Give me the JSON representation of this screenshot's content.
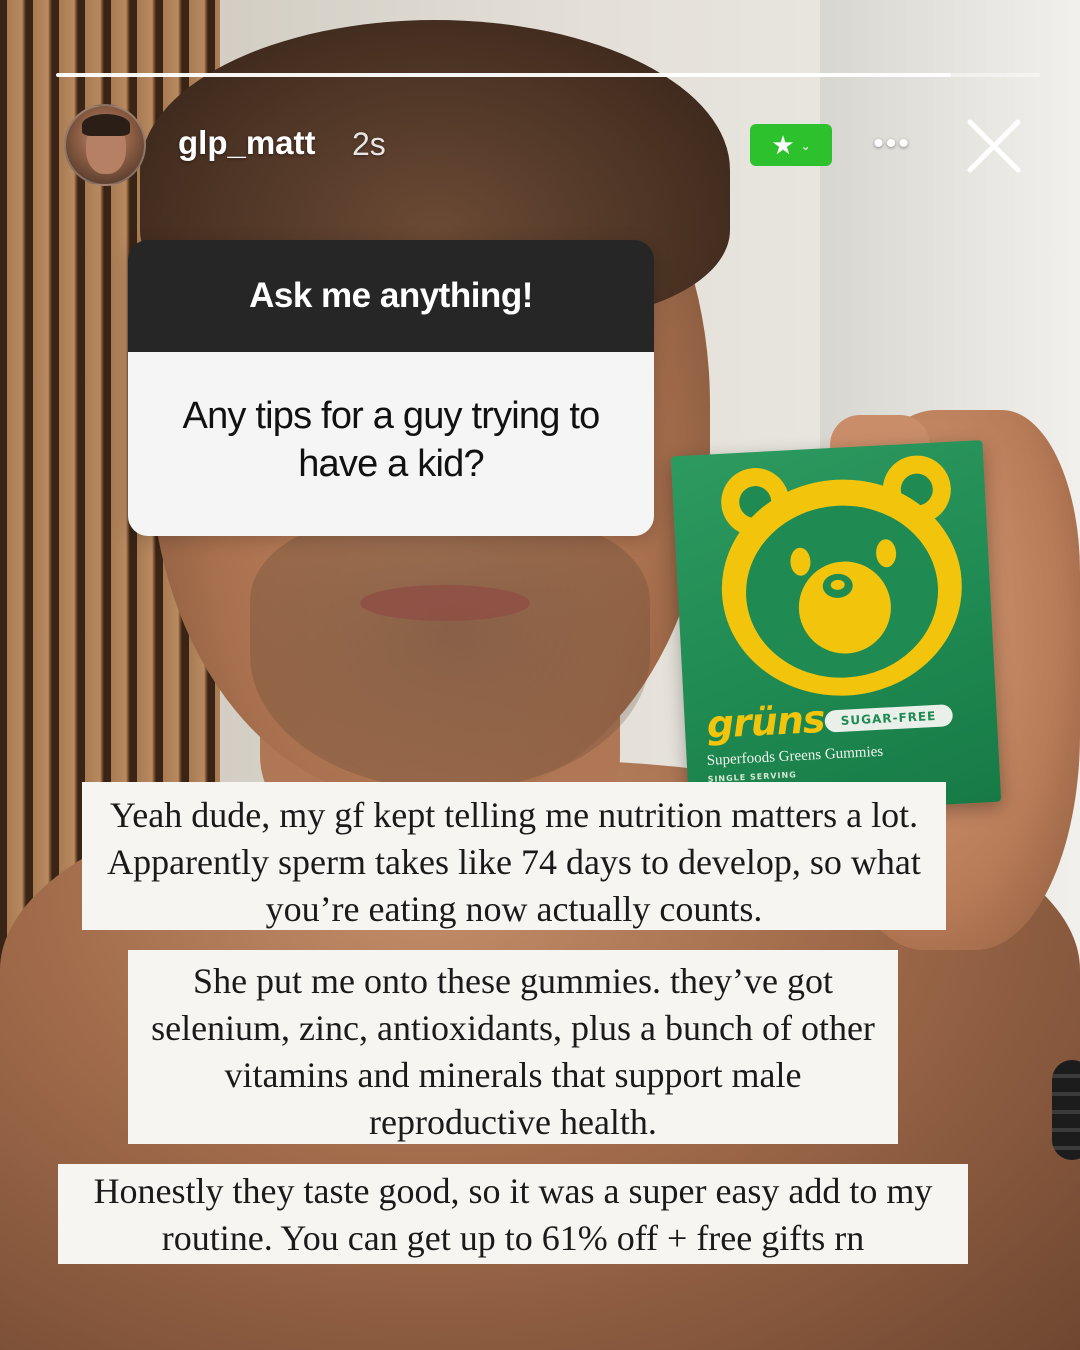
{
  "story": {
    "progress": 0.91,
    "user": {
      "username": "glp_matt",
      "time_ago": "2s",
      "avatar": "avatar-photo"
    },
    "close_friends_badge": {
      "icon": "star-icon",
      "chevron": "chevron-down-icon",
      "color": "#2ec12e"
    },
    "more_icon": "more-horizontal-icon",
    "close_icon": "close-icon"
  },
  "question_sticker": {
    "title": "Ask me anything!",
    "question": "Any tips for a guy trying to have a kid?"
  },
  "product": {
    "brand": "grüns",
    "badge": "SUGAR-FREE",
    "subtitle": "Superfoods Greens Gummies",
    "small_text": "SINGLE SERVING"
  },
  "captions": [
    "Yeah dude, my gf kept telling me nutrition matters a lot. Apparently sperm takes like 74 days to develop, so what you’re eating now actually counts.",
    "She put me onto these gummies. they’ve got selenium, zinc, antioxidants, plus a bunch of other vitamins and minerals that support male reproductive health.",
    "Honestly they taste good, so it was a super easy add to my routine. You can get up to 61% off + free gifts rn"
  ]
}
